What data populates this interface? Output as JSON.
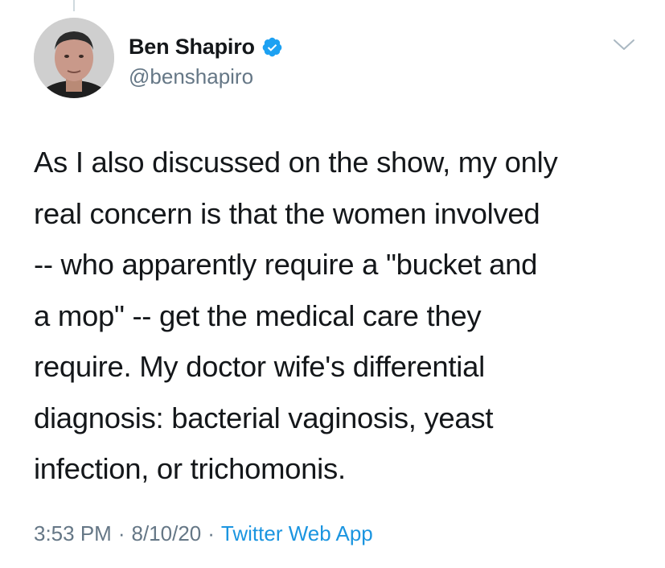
{
  "user": {
    "display_name": "Ben Shapiro",
    "handle": "@benshapiro",
    "verified": true,
    "avatar_icon": "profile-photo"
  },
  "tweet": {
    "text_lines": [
      "As I also discussed on the show, my only",
      "real concern is that the women involved",
      "-- who apparently require a \"bucket and",
      "a mop\" -- get the medical care they",
      "require. My doctor wife's differential",
      "diagnosis: bacterial vaginosis, yeast",
      "infection, or trichomonis."
    ]
  },
  "meta": {
    "time": "3:53 PM",
    "separator": "·",
    "date": "8/10/20",
    "source": "Twitter Web App"
  },
  "icons": {
    "verified": "verified-badge-icon",
    "menu": "chevron-down-icon"
  },
  "colors": {
    "text": "#14171a",
    "secondary": "#657786",
    "link": "#1b95e0",
    "verified": "#1da1f2"
  }
}
